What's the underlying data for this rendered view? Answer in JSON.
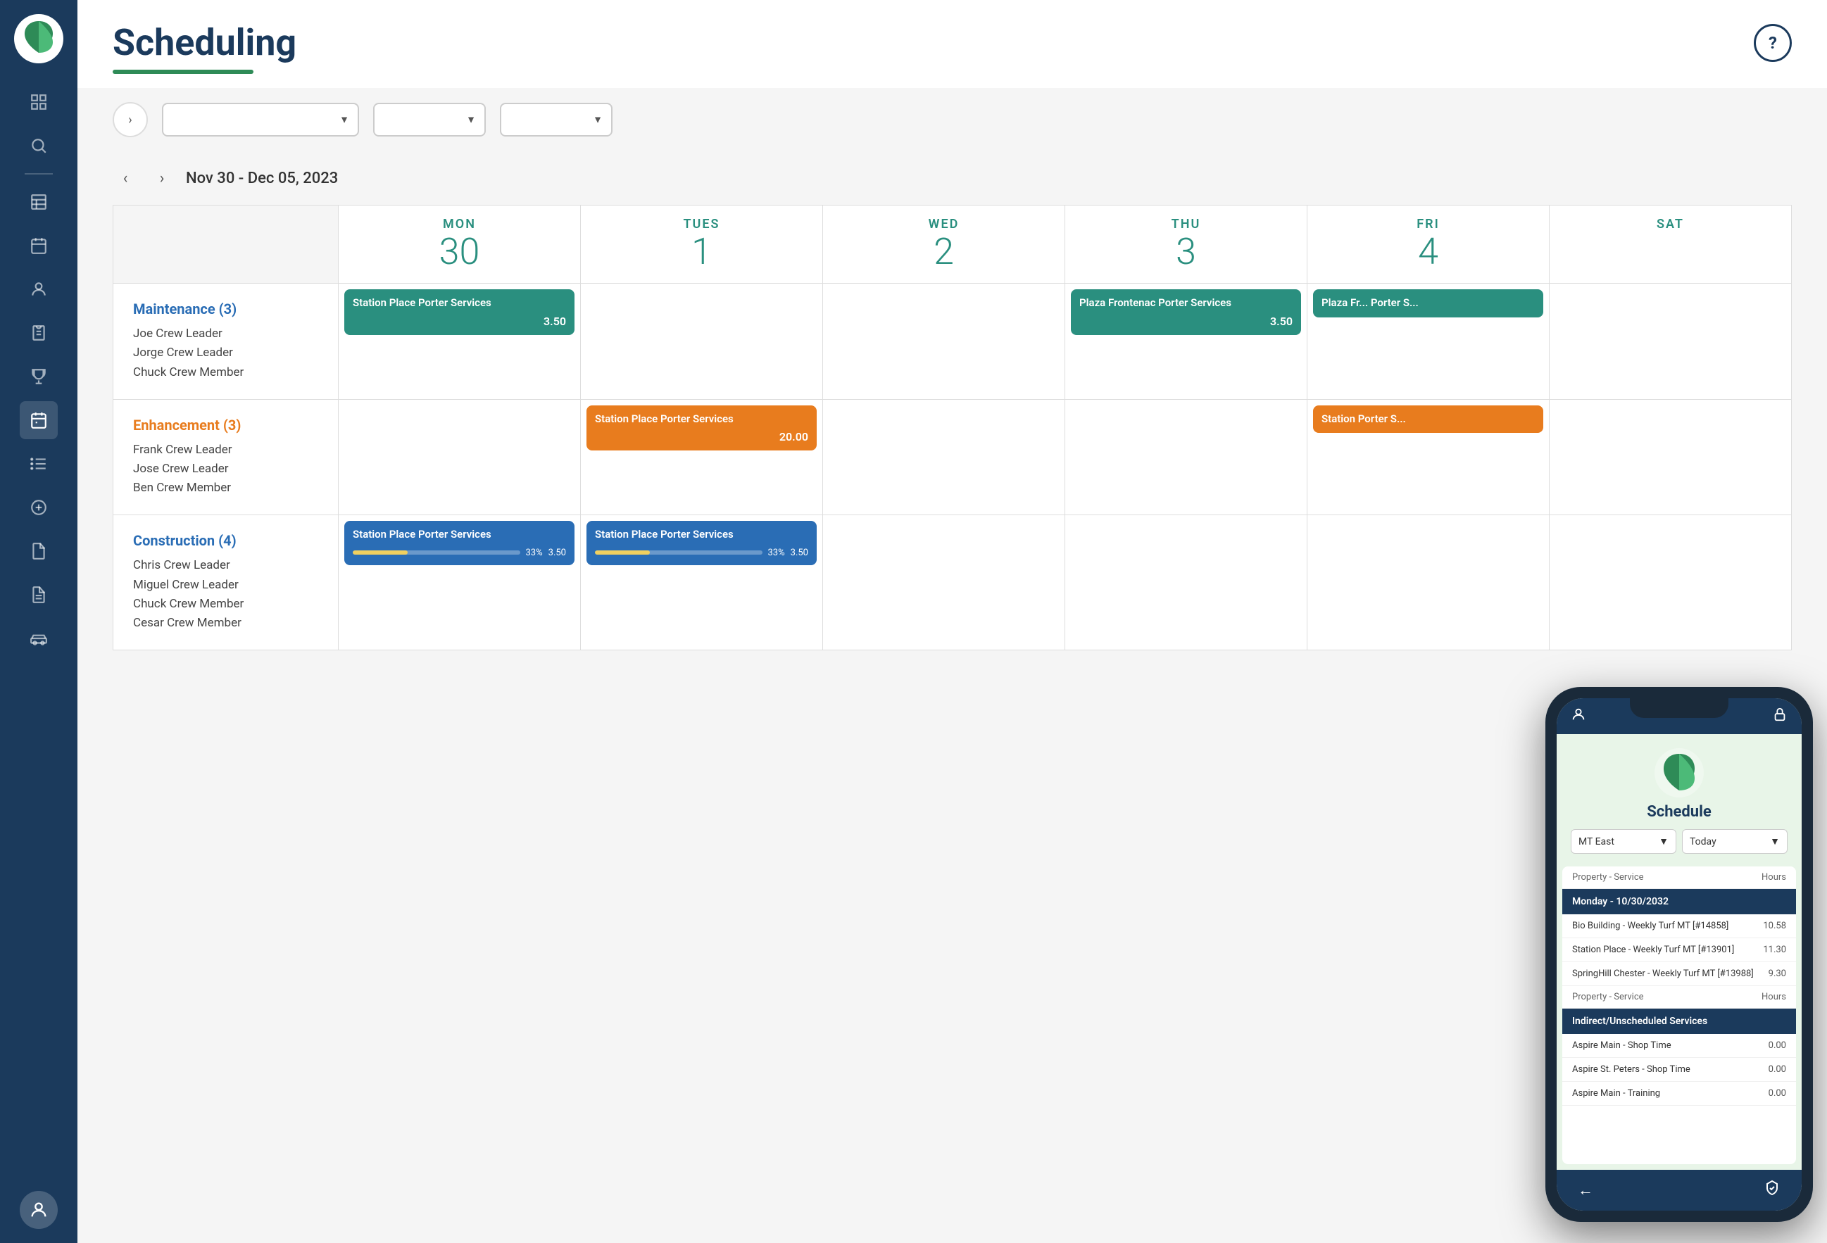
{
  "app": {
    "title": "Scheduling"
  },
  "sidebar": {
    "icons": [
      {
        "name": "grid-icon",
        "symbol": "⊞"
      },
      {
        "name": "search-icon",
        "symbol": "🔍"
      },
      {
        "name": "table-icon",
        "symbol": "▤"
      },
      {
        "name": "calendar-icon",
        "symbol": "📅"
      },
      {
        "name": "person-icon",
        "symbol": "👤"
      },
      {
        "name": "clipboard-icon",
        "symbol": "📋"
      },
      {
        "name": "trophy-icon",
        "symbol": "🏆"
      },
      {
        "name": "schedule-icon",
        "symbol": "📆",
        "active": true
      },
      {
        "name": "list-icon",
        "symbol": "📄"
      },
      {
        "name": "plus-circle-icon",
        "symbol": "⊕"
      },
      {
        "name": "doc-icon",
        "symbol": "📃"
      },
      {
        "name": "file-icon",
        "symbol": "📑"
      },
      {
        "name": "vehicle-icon",
        "symbol": "🚜"
      }
    ]
  },
  "toolbar": {
    "collapse_label": "›",
    "dropdown1_placeholder": "",
    "dropdown2_placeholder": "",
    "dropdown3_placeholder": ""
  },
  "date_nav": {
    "prev_label": "‹",
    "next_label": "›",
    "range": "Nov 30 - Dec 05, 2023"
  },
  "calendar": {
    "days": [
      {
        "name": "MON",
        "number": "30"
      },
      {
        "name": "TUES",
        "number": "1"
      },
      {
        "name": "WED",
        "number": "2"
      },
      {
        "name": "THU",
        "number": "3"
      },
      {
        "name": "FRI",
        "number": "4"
      },
      {
        "name": "SAT",
        "number": ""
      }
    ],
    "rows": [
      {
        "id": "maintenance",
        "label": "Maintenance (3)",
        "label_color": "maintenance",
        "people": [
          "Joe Crew Leader",
          "Jorge Crew Leader",
          "Chuck Crew Member"
        ],
        "events": {
          "MON": {
            "title": "Station Place Porter Services",
            "hours": "3.50",
            "color": "teal"
          },
          "THU": {
            "title": "Plaza Frontenac Porter Services",
            "hours": "3.50",
            "color": "teal"
          },
          "FRI": {
            "title": "Plaza Fr... Porter S...",
            "hours": "",
            "color": "teal",
            "partial": true
          }
        }
      },
      {
        "id": "enhancement",
        "label": "Enhancement (3)",
        "label_color": "enhancement",
        "people": [
          "Frank Crew Leader",
          "Jose Crew Leader",
          "Ben Crew Member"
        ],
        "events": {
          "TUES": {
            "title": "Station Place Porter Services",
            "hours": "20.00",
            "color": "orange"
          },
          "FRI": {
            "title": "Station Porter S...",
            "hours": "",
            "color": "orange",
            "partial": true
          }
        }
      },
      {
        "id": "construction",
        "label": "Construction (4)",
        "label_color": "construction",
        "people": [
          "Chris Crew Leader",
          "Miguel Crew Leader",
          "Chuck Crew Member",
          "Cesar Crew Member"
        ],
        "events": {
          "MON": {
            "title": "Station Place Porter Services",
            "hours": "3.50",
            "color": "blue",
            "progress": 33
          },
          "TUES": {
            "title": "Station Place Porter Services",
            "hours": "3.50",
            "color": "blue",
            "progress": 33
          }
        }
      }
    ]
  },
  "phone": {
    "title": "Schedule",
    "select1": "MT East",
    "select2": "Today",
    "date_header": "Monday - 10/30/2032",
    "col_property": "Property - Service",
    "col_hours": "Hours",
    "scheduled_items": [
      {
        "name": "Bio Building - Weekly Turf MT [#14858]",
        "hours": "10.58"
      },
      {
        "name": "Station Place - Weekly Turf MT [#13901]",
        "hours": "11.30"
      },
      {
        "name": "SpringHill Chester - Weekly Turf MT [#13988]",
        "hours": "9.30"
      }
    ],
    "indirect_header": "Indirect/Unscheduled Services",
    "indirect_items": [
      {
        "name": "Aspire Main - Shop Time",
        "hours": "0.00"
      },
      {
        "name": "Aspire St. Peters - Shop Time",
        "hours": "0.00"
      },
      {
        "name": "Aspire Main - Training",
        "hours": "0.00"
      }
    ]
  }
}
